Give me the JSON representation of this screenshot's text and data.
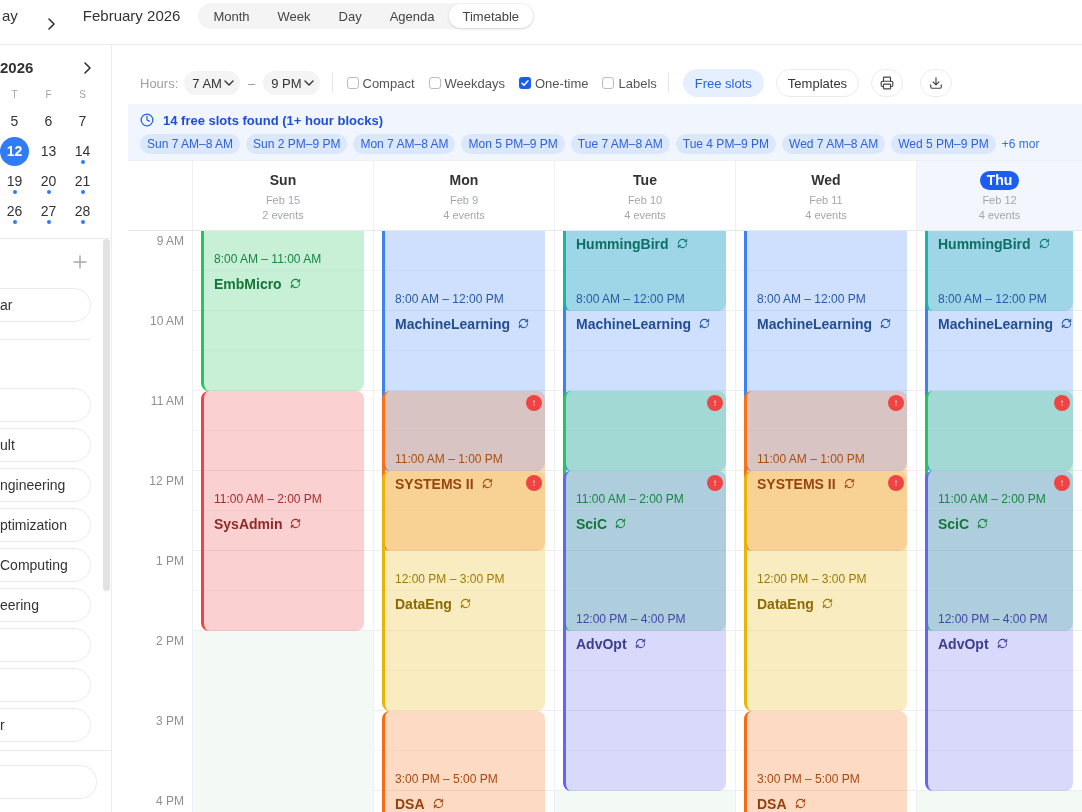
{
  "top_bar": {
    "today_button": "ay",
    "title": "February 2026",
    "views": [
      {
        "label": "Month",
        "selected": false
      },
      {
        "label": "Week",
        "selected": false
      },
      {
        "label": "Day",
        "selected": false
      },
      {
        "label": "Agenda",
        "selected": false
      },
      {
        "label": "Timetable",
        "selected": true
      }
    ]
  },
  "sidebar": {
    "mini_calendar": {
      "title": "2026",
      "weekdays": [
        "T",
        "F",
        "S"
      ],
      "weeks": [
        [
          {
            "day": "5",
            "selected": false,
            "has_events": false
          },
          {
            "day": "6",
            "selected": false,
            "has_events": false
          },
          {
            "day": "7",
            "selected": false,
            "has_events": false
          }
        ],
        [
          {
            "day": "12",
            "selected": true,
            "has_events": false
          },
          {
            "day": "13",
            "selected": false,
            "has_events": false
          },
          {
            "day": "14",
            "selected": false,
            "has_events": true
          }
        ],
        [
          {
            "day": "19",
            "selected": false,
            "has_events": true
          },
          {
            "day": "20",
            "selected": false,
            "has_events": true
          },
          {
            "day": "21",
            "selected": false,
            "has_events": true
          }
        ],
        [
          {
            "day": "26",
            "selected": false,
            "has_events": true
          },
          {
            "day": "27",
            "selected": false,
            "has_events": true
          },
          {
            "day": "28",
            "selected": false,
            "has_events": true
          }
        ]
      ]
    },
    "list_1": [
      {
        "label": "ar",
        "selected": false
      }
    ],
    "list_2": [
      {
        "selected": false
      },
      {
        "label": "ult",
        "selected": false
      },
      {
        "label": "ngineering",
        "selected": false
      },
      {
        "label": "ptimization",
        "selected": false
      },
      {
        "label": "Computing",
        "selected": false
      },
      {
        "label": "eering",
        "selected": false
      },
      {
        "selected": false
      },
      {
        "selected": false
      },
      {
        "label": "r",
        "selected": false
      }
    ],
    "footer": [
      {
        "selected": false
      }
    ]
  },
  "toolbar": {
    "hours_label": "Hours:",
    "hours_from": "7 AM",
    "range_separator": "–",
    "hours_to": "9 PM",
    "options": [
      {
        "label": "Compact",
        "checked": false
      },
      {
        "label": "Weekdays",
        "checked": false
      },
      {
        "label": "One-time",
        "checked": true
      },
      {
        "label": "Labels",
        "checked": false
      }
    ],
    "buttons": [
      {
        "label": "Free slots",
        "selected": true
      },
      {
        "label": "Templates",
        "selected": false
      }
    ]
  },
  "free_slots": {
    "summary": "14 free slots found (1+ hour blocks)",
    "slots": [
      "Sun 7 AM–8 AM",
      "Sun 2 PM–9 PM",
      "Mon 7 AM–8 AM",
      "Mon 5 PM–9 PM",
      "Tue 7 AM–8 AM",
      "Tue 4 PM–9 PM",
      "Wed 7 AM–8 AM",
      "Wed 5 PM–9 PM"
    ],
    "more": "+6 mor"
  },
  "calendar": {
    "hours": [
      "9 AM",
      "10 AM",
      "11 AM",
      "12 PM",
      "1 PM",
      "2 PM",
      "3 PM",
      "4 PM"
    ],
    "days": [
      {
        "name": "Sun",
        "date": "Feb 15",
        "count": "2 events",
        "today": false,
        "events": [
          {
            "title": "EmbMicro",
            "time": "8:00 AM – 11:00 AM",
            "color": "#22c55e",
            "recurring": true,
            "conflict": false
          },
          {
            "title": "SysAdmin",
            "time": "11:00 AM – 2:00 PM",
            "color": "#ef4444",
            "recurring": true,
            "conflict": false
          }
        ]
      },
      {
        "name": "Mon",
        "date": "Feb 9",
        "count": "4 events",
        "today": false,
        "events": [
          {
            "title": "MachineLearning",
            "time": "8:00 AM – 12:00 PM",
            "color": "#3b82f6",
            "recurring": true,
            "conflict": false
          },
          {
            "title": "SYSTEMS II",
            "time": "11:00 AM – 1:00 PM",
            "color": "#f97316",
            "recurring": true,
            "conflict": true
          },
          {
            "title": "DataEng",
            "time": "12:00 PM – 3:00 PM",
            "color": "#eab308",
            "recurring": true,
            "conflict": false
          },
          {
            "title": "DSA",
            "time": "3:00 PM – 5:00 PM",
            "color": "#f76b15",
            "recurring": true,
            "conflict": false
          }
        ]
      },
      {
        "name": "Tue",
        "date": "Feb 10",
        "count": "4 events",
        "today": false,
        "events": [
          {
            "title": "HummingBird",
            "color": "#14b8a6",
            "recurring": true,
            "conflict": false
          },
          {
            "title": "MachineLearning",
            "time": "8:00 AM – 12:00 PM",
            "color": "#3b82f6",
            "recurring": true,
            "conflict": false
          },
          {
            "title": "SciC",
            "time": "11:00 AM – 2:00 PM",
            "color": "#22c55e",
            "recurring": true,
            "conflict": true
          },
          {
            "title": "AdvOpt",
            "time": "12:00 PM – 4:00 PM",
            "color": "#6366f1",
            "recurring": true,
            "conflict": false
          }
        ]
      },
      {
        "name": "Wed",
        "date": "Feb 11",
        "count": "4 events",
        "today": false,
        "events": [
          {
            "title": "MachineLearning",
            "time": "8:00 AM – 12:00 PM",
            "color": "#3b82f6",
            "recurring": true,
            "conflict": false
          },
          {
            "title": "SYSTEMS II",
            "time": "11:00 AM – 1:00 PM",
            "color": "#f97316",
            "recurring": true,
            "conflict": true
          },
          {
            "title": "DataEng",
            "time": "12:00 PM – 3:00 PM",
            "color": "#eab308",
            "recurring": true,
            "conflict": false
          },
          {
            "title": "DSA",
            "time": "3:00 PM – 5:00 PM",
            "color": "#f76b15",
            "recurring": true,
            "conflict": false
          }
        ]
      },
      {
        "name": "Thu",
        "date": "Feb 12",
        "count": "4 events",
        "today": true,
        "events": [
          {
            "title": "HummingBird",
            "color": "#14b8a6",
            "recurring": true,
            "conflict": false
          },
          {
            "title": "MachineLearning",
            "time": "8:00 AM – 12:00 PM",
            "color": "#3b82f6",
            "recurring": true,
            "conflict": false
          },
          {
            "title": "SciC",
            "time": "11:00 AM – 2:00 PM",
            "color": "#22c55e",
            "recurring": true,
            "conflict": true
          },
          {
            "title": "AdvOpt",
            "time": "12:00 PM – 4:00 PM",
            "color": "#6366f1",
            "recurring": true,
            "conflict": false
          }
        ]
      }
    ]
  }
}
